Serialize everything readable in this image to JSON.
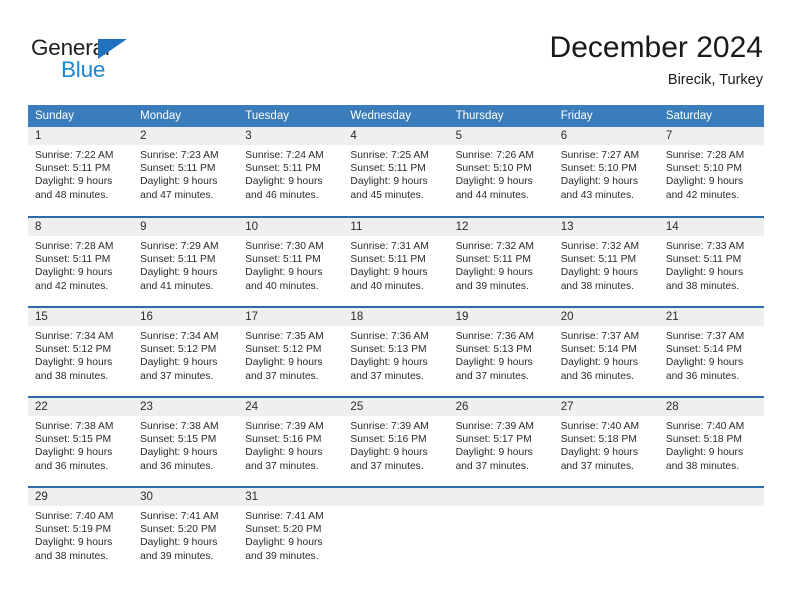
{
  "brand": {
    "name_top": "General",
    "name_bottom": "Blue",
    "accent_dark": "#1f72bd",
    "accent_light": "#1b86d4"
  },
  "header": {
    "title": "December 2024",
    "location": "Birecik, Turkey"
  },
  "theme": {
    "header_blue": "#3b7dba",
    "row_divider": "#2c6aa8",
    "day_band": "#efefef"
  },
  "weekdays": [
    "Sunday",
    "Monday",
    "Tuesday",
    "Wednesday",
    "Thursday",
    "Friday",
    "Saturday"
  ],
  "weeks": [
    [
      {
        "day": "1",
        "sunrise": "Sunrise: 7:22 AM",
        "sunset": "Sunset: 5:11 PM",
        "daylight1": "Daylight: 9 hours",
        "daylight2": "and 48 minutes."
      },
      {
        "day": "2",
        "sunrise": "Sunrise: 7:23 AM",
        "sunset": "Sunset: 5:11 PM",
        "daylight1": "Daylight: 9 hours",
        "daylight2": "and 47 minutes."
      },
      {
        "day": "3",
        "sunrise": "Sunrise: 7:24 AM",
        "sunset": "Sunset: 5:11 PM",
        "daylight1": "Daylight: 9 hours",
        "daylight2": "and 46 minutes."
      },
      {
        "day": "4",
        "sunrise": "Sunrise: 7:25 AM",
        "sunset": "Sunset: 5:11 PM",
        "daylight1": "Daylight: 9 hours",
        "daylight2": "and 45 minutes."
      },
      {
        "day": "5",
        "sunrise": "Sunrise: 7:26 AM",
        "sunset": "Sunset: 5:10 PM",
        "daylight1": "Daylight: 9 hours",
        "daylight2": "and 44 minutes."
      },
      {
        "day": "6",
        "sunrise": "Sunrise: 7:27 AM",
        "sunset": "Sunset: 5:10 PM",
        "daylight1": "Daylight: 9 hours",
        "daylight2": "and 43 minutes."
      },
      {
        "day": "7",
        "sunrise": "Sunrise: 7:28 AM",
        "sunset": "Sunset: 5:10 PM",
        "daylight1": "Daylight: 9 hours",
        "daylight2": "and 42 minutes."
      }
    ],
    [
      {
        "day": "8",
        "sunrise": "Sunrise: 7:28 AM",
        "sunset": "Sunset: 5:11 PM",
        "daylight1": "Daylight: 9 hours",
        "daylight2": "and 42 minutes."
      },
      {
        "day": "9",
        "sunrise": "Sunrise: 7:29 AM",
        "sunset": "Sunset: 5:11 PM",
        "daylight1": "Daylight: 9 hours",
        "daylight2": "and 41 minutes."
      },
      {
        "day": "10",
        "sunrise": "Sunrise: 7:30 AM",
        "sunset": "Sunset: 5:11 PM",
        "daylight1": "Daylight: 9 hours",
        "daylight2": "and 40 minutes."
      },
      {
        "day": "11",
        "sunrise": "Sunrise: 7:31 AM",
        "sunset": "Sunset: 5:11 PM",
        "daylight1": "Daylight: 9 hours",
        "daylight2": "and 40 minutes."
      },
      {
        "day": "12",
        "sunrise": "Sunrise: 7:32 AM",
        "sunset": "Sunset: 5:11 PM",
        "daylight1": "Daylight: 9 hours",
        "daylight2": "and 39 minutes."
      },
      {
        "day": "13",
        "sunrise": "Sunrise: 7:32 AM",
        "sunset": "Sunset: 5:11 PM",
        "daylight1": "Daylight: 9 hours",
        "daylight2": "and 38 minutes."
      },
      {
        "day": "14",
        "sunrise": "Sunrise: 7:33 AM",
        "sunset": "Sunset: 5:11 PM",
        "daylight1": "Daylight: 9 hours",
        "daylight2": "and 38 minutes."
      }
    ],
    [
      {
        "day": "15",
        "sunrise": "Sunrise: 7:34 AM",
        "sunset": "Sunset: 5:12 PM",
        "daylight1": "Daylight: 9 hours",
        "daylight2": "and 38 minutes."
      },
      {
        "day": "16",
        "sunrise": "Sunrise: 7:34 AM",
        "sunset": "Sunset: 5:12 PM",
        "daylight1": "Daylight: 9 hours",
        "daylight2": "and 37 minutes."
      },
      {
        "day": "17",
        "sunrise": "Sunrise: 7:35 AM",
        "sunset": "Sunset: 5:12 PM",
        "daylight1": "Daylight: 9 hours",
        "daylight2": "and 37 minutes."
      },
      {
        "day": "18",
        "sunrise": "Sunrise: 7:36 AM",
        "sunset": "Sunset: 5:13 PM",
        "daylight1": "Daylight: 9 hours",
        "daylight2": "and 37 minutes."
      },
      {
        "day": "19",
        "sunrise": "Sunrise: 7:36 AM",
        "sunset": "Sunset: 5:13 PM",
        "daylight1": "Daylight: 9 hours",
        "daylight2": "and 37 minutes."
      },
      {
        "day": "20",
        "sunrise": "Sunrise: 7:37 AM",
        "sunset": "Sunset: 5:14 PM",
        "daylight1": "Daylight: 9 hours",
        "daylight2": "and 36 minutes."
      },
      {
        "day": "21",
        "sunrise": "Sunrise: 7:37 AM",
        "sunset": "Sunset: 5:14 PM",
        "daylight1": "Daylight: 9 hours",
        "daylight2": "and 36 minutes."
      }
    ],
    [
      {
        "day": "22",
        "sunrise": "Sunrise: 7:38 AM",
        "sunset": "Sunset: 5:15 PM",
        "daylight1": "Daylight: 9 hours",
        "daylight2": "and 36 minutes."
      },
      {
        "day": "23",
        "sunrise": "Sunrise: 7:38 AM",
        "sunset": "Sunset: 5:15 PM",
        "daylight1": "Daylight: 9 hours",
        "daylight2": "and 36 minutes."
      },
      {
        "day": "24",
        "sunrise": "Sunrise: 7:39 AM",
        "sunset": "Sunset: 5:16 PM",
        "daylight1": "Daylight: 9 hours",
        "daylight2": "and 37 minutes."
      },
      {
        "day": "25",
        "sunrise": "Sunrise: 7:39 AM",
        "sunset": "Sunset: 5:16 PM",
        "daylight1": "Daylight: 9 hours",
        "daylight2": "and 37 minutes."
      },
      {
        "day": "26",
        "sunrise": "Sunrise: 7:39 AM",
        "sunset": "Sunset: 5:17 PM",
        "daylight1": "Daylight: 9 hours",
        "daylight2": "and 37 minutes."
      },
      {
        "day": "27",
        "sunrise": "Sunrise: 7:40 AM",
        "sunset": "Sunset: 5:18 PM",
        "daylight1": "Daylight: 9 hours",
        "daylight2": "and 37 minutes."
      },
      {
        "day": "28",
        "sunrise": "Sunrise: 7:40 AM",
        "sunset": "Sunset: 5:18 PM",
        "daylight1": "Daylight: 9 hours",
        "daylight2": "and 38 minutes."
      }
    ],
    [
      {
        "day": "29",
        "sunrise": "Sunrise: 7:40 AM",
        "sunset": "Sunset: 5:19 PM",
        "daylight1": "Daylight: 9 hours",
        "daylight2": "and 38 minutes."
      },
      {
        "day": "30",
        "sunrise": "Sunrise: 7:41 AM",
        "sunset": "Sunset: 5:20 PM",
        "daylight1": "Daylight: 9 hours",
        "daylight2": "and 39 minutes."
      },
      {
        "day": "31",
        "sunrise": "Sunrise: 7:41 AM",
        "sunset": "Sunset: 5:20 PM",
        "daylight1": "Daylight: 9 hours",
        "daylight2": "and 39 minutes."
      },
      {
        "day": "",
        "sunrise": "",
        "sunset": "",
        "daylight1": "",
        "daylight2": ""
      },
      {
        "day": "",
        "sunrise": "",
        "sunset": "",
        "daylight1": "",
        "daylight2": ""
      },
      {
        "day": "",
        "sunrise": "",
        "sunset": "",
        "daylight1": "",
        "daylight2": ""
      },
      {
        "day": "",
        "sunrise": "",
        "sunset": "",
        "daylight1": "",
        "daylight2": ""
      }
    ]
  ]
}
